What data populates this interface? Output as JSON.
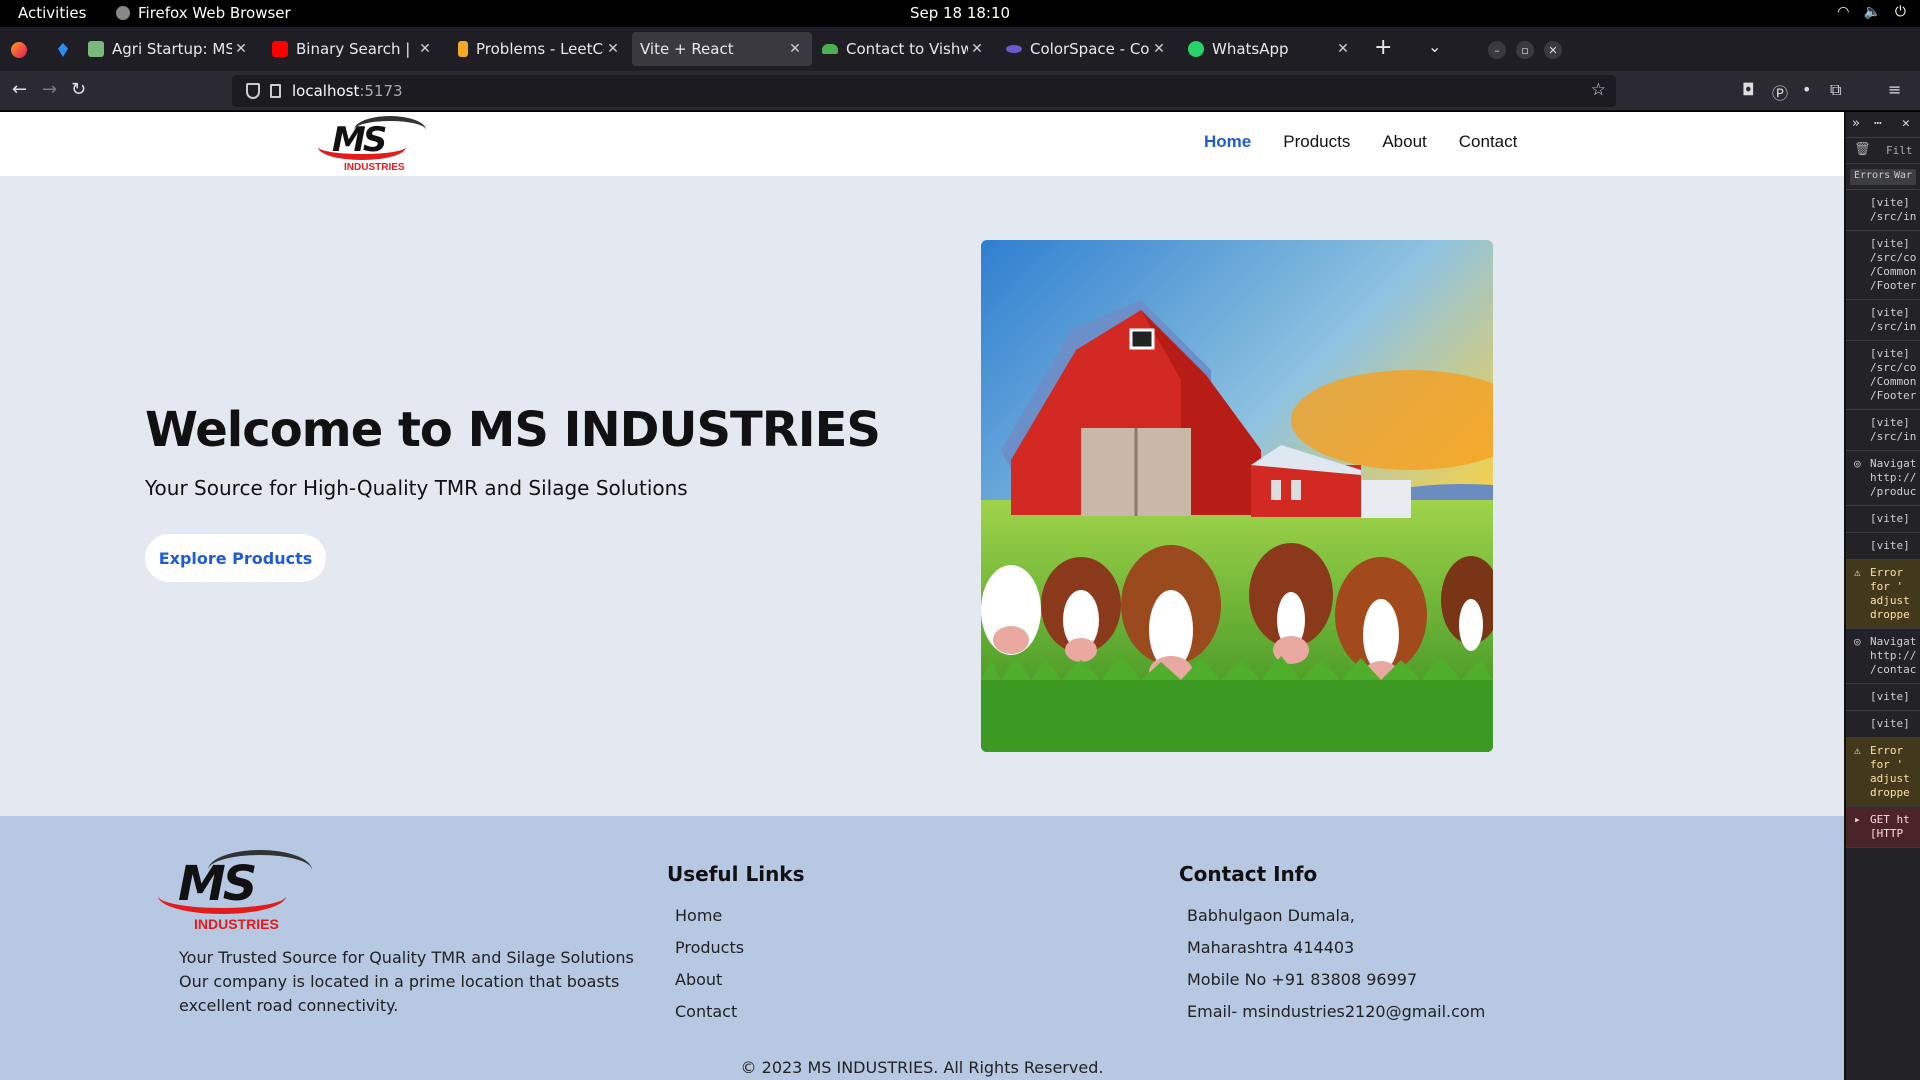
{
  "os": {
    "activities_label": "Activities",
    "app_name": "Firefox Web Browser",
    "clock": "Sep 18  18:10"
  },
  "browser": {
    "tabs": [
      {
        "title": "Agri Startup: MS INDUSTRIES",
        "favicon_color": "#7ab97a"
      },
      {
        "title": "Binary Search | Interview",
        "favicon_color": "#ff0000"
      },
      {
        "title": "Problems - LeetCode",
        "favicon_color": "#f5a623"
      },
      {
        "title": "Vite + React",
        "favicon_color": "#3a3940"
      },
      {
        "title": "Contact to Vishwa Agro Tech",
        "favicon_color": "#4caf50"
      },
      {
        "title": "ColorSpace - Color Palette",
        "favicon_color": "#6a5acd"
      },
      {
        "title": "WhatsApp",
        "favicon_color": "#25d366"
      }
    ],
    "url_host": "localhost",
    "url_port": ":5173"
  },
  "site": {
    "logo_text": "MS",
    "logo_sub": "INDUSTRIES",
    "nav": [
      "Home",
      "Products",
      "About",
      "Contact"
    ],
    "active_nav": "Home",
    "accent_color": "#1e5bd8",
    "hero": {
      "title": "Welcome to MS INDUSTRIES",
      "subtitle": "Your Source for High-Quality TMR and Silage Solutions",
      "cta": "Explore Products"
    },
    "footer": {
      "about_text": "Your Trusted Source for Quality TMR and Silage Solutions Our company is located in a prime location that boasts excellent road connectivity.",
      "links_heading": "Useful Links",
      "links": [
        "Home",
        "Products",
        "About",
        "Contact"
      ],
      "contact_heading": "Contact Info",
      "contact_lines": [
        "Babhulgaon Dumala,",
        "Maharashtra 414403",
        "Mobile No +91 83808 96997",
        "Email- msindustries2120@gmail.com"
      ],
      "copyright": "© 2023 MS INDUSTRIES. All Rights Reserved."
    }
  },
  "devtools": {
    "filter_placeholder": "Filt",
    "filter_tabs": [
      "Errors",
      "War"
    ],
    "logs": [
      {
        "kind": "info",
        "text": "[vite] \n/src/in"
      },
      {
        "kind": "info",
        "text": "[vite] \n/src/co\n/Common\n/Footer"
      },
      {
        "kind": "info",
        "text": "[vite] \n/src/in"
      },
      {
        "kind": "info",
        "text": "[vite] \n/src/co\n/Common\n/Footer"
      },
      {
        "kind": "info",
        "text": "[vite] \n/src/in"
      },
      {
        "kind": "nav",
        "text": "Navigat\nhttp://\n/produc"
      },
      {
        "kind": "info",
        "text": "[vite] "
      },
      {
        "kind": "info",
        "text": "[vite] "
      },
      {
        "kind": "warn",
        "text": "Error \nfor '\nadjust\ndroppe"
      },
      {
        "kind": "nav",
        "text": "Navigat\nhttp://\n/contac"
      },
      {
        "kind": "info",
        "text": "[vite] "
      },
      {
        "kind": "info",
        "text": "[vite] "
      },
      {
        "kind": "warn",
        "text": "Error \nfor '\nadjust\ndroppe"
      },
      {
        "kind": "err",
        "text": "GET ht\n[HTTP"
      }
    ]
  }
}
